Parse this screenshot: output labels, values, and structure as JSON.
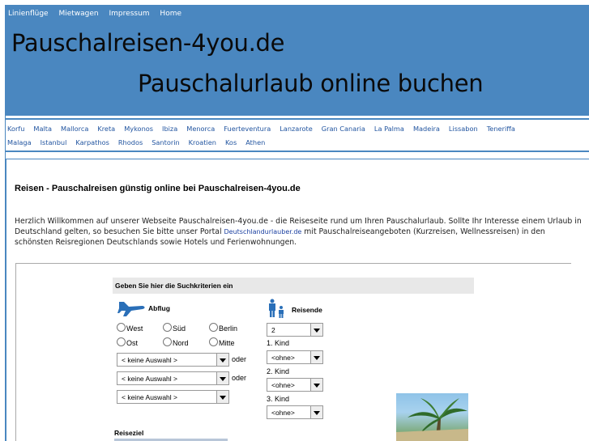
{
  "topnav": [
    "Linienflüge",
    "Mietwagen",
    "Impressum",
    "Home"
  ],
  "header": {
    "title": "Pauschalreisen-4you.de",
    "subtitle": "Pauschalurlaub  online buchen"
  },
  "destinations_row1": [
    "Korfu",
    "Malta",
    "Mallorca",
    "Kreta",
    "Mykonos",
    "Ibiza",
    "Menorca",
    "Fuerteventura",
    "Lanzarote",
    "Gran Canaria",
    "La Palma",
    "Madeira",
    "Lissabon",
    "Teneriffa"
  ],
  "destinations_row2": [
    "Malaga",
    "Istanbul",
    "Karpathos",
    "Rhodos",
    "Santorin",
    "Kroatien",
    "Kos",
    "Athen"
  ],
  "main": {
    "heading": "Reisen - Pauschalreisen günstig online bei Pauschalreisen-4you.de",
    "intro_before": "Herzlich Willkommen auf unserer Webseite Pauschalreisen-4you.de - die Reiseseite rund um Ihren Pauschalurlaub. Sollte Ihr Interesse einem Urlaub in Deutschland gelten, so besuchen Sie bitte unser Portal ",
    "intro_link": "Deutschlandurlauber.de",
    "intro_after": " mit Pauschalreiseangeboten (Kurzreisen, Wellnessreisen) in den schönsten Reisregionen Deutschlands sowie Hotels und Ferienwohnungen."
  },
  "search": {
    "title": "Geben Sie hier die Suchkriterien ein",
    "abflug_label": "Abflug",
    "reisende_label": "Reisende",
    "radios": [
      "West",
      "Süd",
      "Berlin",
      "Ost",
      "Nord",
      "Mitte"
    ],
    "airport_select": "< keine Auswahl >",
    "oder": "oder",
    "travellers": "2",
    "kind1": "1. Kind",
    "kind2": "2. Kind",
    "kind3": "3. Kind",
    "ohne": "<ohne>",
    "reiseziel_label": "Reiseziel"
  },
  "colors": {
    "header_bg": "#4a87c0",
    "link": "#2255a0"
  }
}
